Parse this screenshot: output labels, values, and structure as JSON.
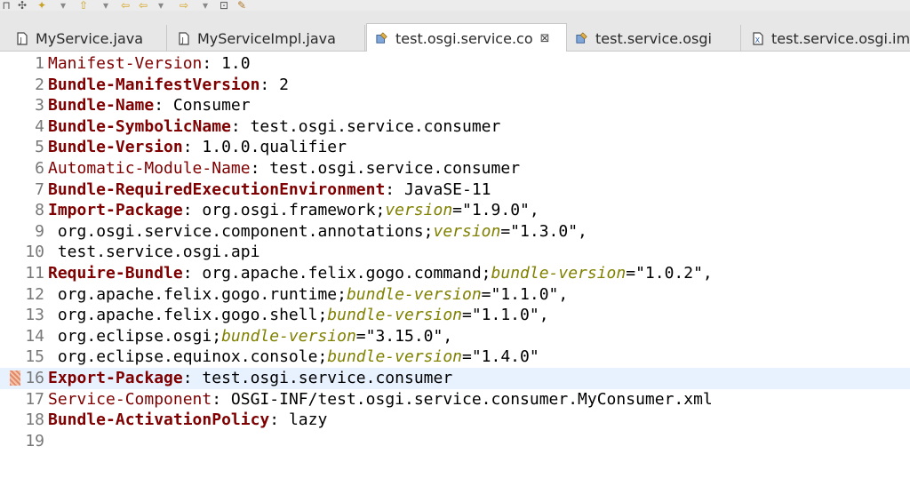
{
  "tabs": [
    {
      "label": "MyService.java",
      "icon": "java-file-icon",
      "active": false
    },
    {
      "label": "MyServiceImpl.java",
      "icon": "java-file-icon",
      "active": false
    },
    {
      "label": "test.osgi.service.co",
      "icon": "plugin-manifest-icon",
      "active": true
    },
    {
      "label": "test.service.osgi",
      "icon": "plugin-manifest-icon",
      "active": false
    },
    {
      "label": "test.service.osgi.im",
      "icon": "xml-file-icon",
      "active": false
    }
  ],
  "close_glyph": "⊠",
  "editor": {
    "lines": [
      {
        "num": "1",
        "key": "Manifest-Version",
        "key_bold": false,
        "sep": ": ",
        "value": "1.0"
      },
      {
        "num": "2",
        "key": "Bundle-ManifestVersion",
        "key_bold": true,
        "sep": ": ",
        "value": "2"
      },
      {
        "num": "3",
        "key": "Bundle-Name",
        "key_bold": true,
        "sep": ": ",
        "value": "Consumer"
      },
      {
        "num": "4",
        "key": "Bundle-SymbolicName",
        "key_bold": true,
        "sep": ": ",
        "value": "test.osgi.service.consumer"
      },
      {
        "num": "5",
        "key": "Bundle-Version",
        "key_bold": true,
        "sep": ": ",
        "value": "1.0.0.qualifier"
      },
      {
        "num": "6",
        "key": "Automatic-Module-Name",
        "key_bold": false,
        "sep": ": ",
        "value": "test.osgi.service.consumer"
      },
      {
        "num": "7",
        "key": "Bundle-RequiredExecutionEnvironment",
        "key_bold": true,
        "sep": ": ",
        "value": "JavaSE-11"
      },
      {
        "num": "8",
        "key": "Import-Package",
        "key_bold": true,
        "sep": ": ",
        "value": "org.osgi.framework;",
        "attr": "version",
        "attr_value": "=\"1.9.0\","
      },
      {
        "num": "9",
        "key": "",
        "key_bold": false,
        "sep": " ",
        "value": "org.osgi.service.component.annotations;",
        "attr": "version",
        "attr_value": "=\"1.3.0\","
      },
      {
        "num": "10",
        "key": "",
        "key_bold": false,
        "sep": " ",
        "value": "test.service.osgi.api"
      },
      {
        "num": "11",
        "key": "Require-Bundle",
        "key_bold": true,
        "sep": ": ",
        "value": "org.apache.felix.gogo.command;",
        "attr": "bundle-version",
        "attr_value": "=\"1.0.2\","
      },
      {
        "num": "12",
        "key": "",
        "key_bold": false,
        "sep": " ",
        "value": "org.apache.felix.gogo.runtime;",
        "attr": "bundle-version",
        "attr_value": "=\"1.1.0\","
      },
      {
        "num": "13",
        "key": "",
        "key_bold": false,
        "sep": " ",
        "value": "org.apache.felix.gogo.shell;",
        "attr": "bundle-version",
        "attr_value": "=\"1.1.0\","
      },
      {
        "num": "14",
        "key": "",
        "key_bold": false,
        "sep": " ",
        "value": "org.eclipse.osgi;",
        "attr": "bundle-version",
        "attr_value": "=\"3.15.0\","
      },
      {
        "num": "15",
        "key": "",
        "key_bold": false,
        "sep": " ",
        "value": "org.eclipse.equinox.console;",
        "attr": "bundle-version",
        "attr_value": "=\"1.4.0\""
      },
      {
        "num": "16",
        "key": "Export-Package",
        "key_bold": true,
        "sep": ": ",
        "value": "test.osgi.service.consumer",
        "current": true
      },
      {
        "num": "17",
        "key": "Service-Component",
        "key_bold": false,
        "sep": ": ",
        "value": "OSGI-INF/test.osgi.service.consumer.MyConsumer.xml"
      },
      {
        "num": "18",
        "key": "Bundle-ActivationPolicy",
        "key_bold": true,
        "sep": ": ",
        "value": "lazy"
      },
      {
        "num": "19",
        "key": "",
        "key_bold": false,
        "sep": "",
        "value": ""
      }
    ]
  },
  "colors": {
    "header_key": "#7f0000",
    "attribute": "#808000",
    "line_number": "#787878",
    "current_line": "#e8f2fe"
  }
}
